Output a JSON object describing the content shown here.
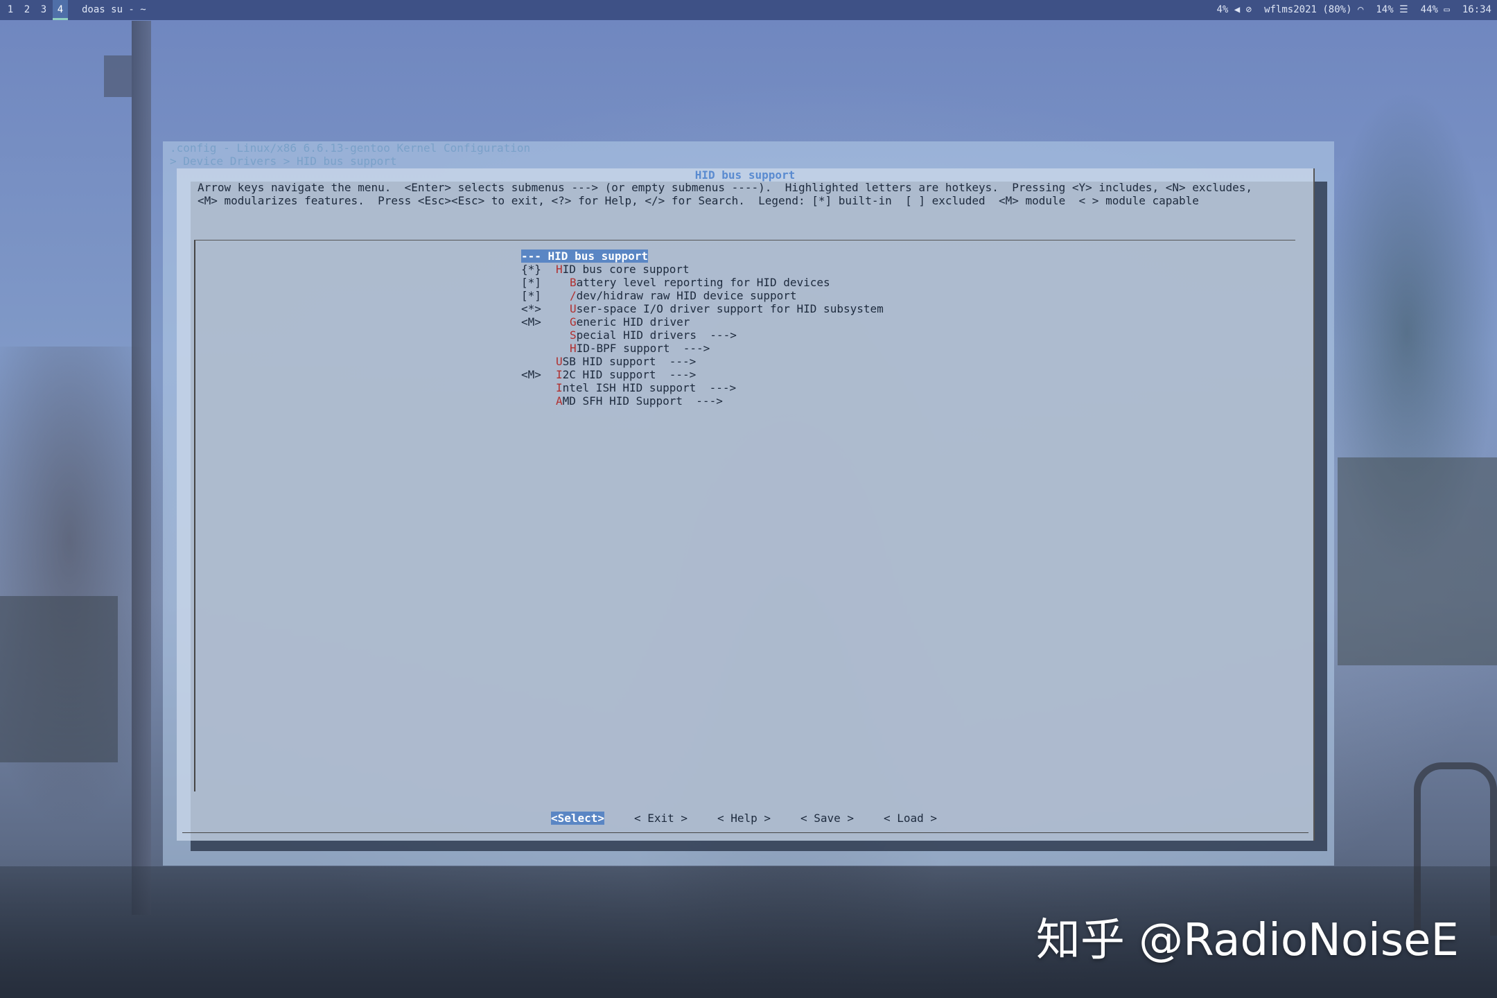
{
  "topbar": {
    "workspaces": [
      "1",
      "2",
      "3",
      "4"
    ],
    "active_workspace": "4",
    "window_title": "doas su - ~",
    "status": {
      "volume": "4%",
      "network": "wflms2021 (80%)",
      "cpu": "14%",
      "battery": "44%",
      "clock": "16:34"
    }
  },
  "terminal": {
    "header_line1": ".config - Linux/x86 6.6.13-gentoo Kernel Configuration",
    "header_line2": "> Device Drivers > HID bus support"
  },
  "dialog": {
    "title": "HID bus support",
    "help_line1": "Arrow keys navigate the menu.  <Enter> selects submenus ---> (or empty submenus ----).  Highlighted letters are hotkeys.  Pressing <Y> includes, <N> excludes,",
    "help_line2": "<M> modularizes features.  Press <Esc><Esc> to exit, <?> for Help, </> for Search.  Legend: [*] built-in  [ ] excluded  <M> module  < > module capable",
    "items": [
      {
        "mark": "",
        "hotkey": "",
        "rest": "--- HID bus support",
        "indent": 0,
        "selected": true
      },
      {
        "mark": "{*}",
        "hotkey": "H",
        "rest": "ID bus core support",
        "indent": 1,
        "selected": false
      },
      {
        "mark": "[*]",
        "hotkey": "B",
        "rest": "attery level reporting for HID devices",
        "indent": 2,
        "selected": false
      },
      {
        "mark": "[*]",
        "hotkey": "/",
        "rest": "dev/hidraw raw HID device support",
        "indent": 2,
        "selected": false
      },
      {
        "mark": "<*>",
        "hotkey": "U",
        "rest": "ser-space I/O driver support for HID subsystem",
        "indent": 2,
        "selected": false
      },
      {
        "mark": "<M>",
        "hotkey": "G",
        "rest": "eneric HID driver",
        "indent": 2,
        "selected": false
      },
      {
        "mark": "",
        "hotkey": "S",
        "rest": "pecial HID drivers  --->",
        "indent": 2,
        "selected": false
      },
      {
        "mark": "",
        "hotkey": "H",
        "rest": "ID-BPF support  --->",
        "indent": 2,
        "selected": false
      },
      {
        "mark": "",
        "hotkey": "U",
        "rest": "SB HID support  --->",
        "indent": 1,
        "selected": false
      },
      {
        "mark": "<M>",
        "hotkey": "I",
        "rest": "2C HID support  --->",
        "indent": 1,
        "selected": false
      },
      {
        "mark": "",
        "hotkey": "I",
        "rest": "ntel ISH HID support  --->",
        "indent": 1,
        "selected": false
      },
      {
        "mark": "",
        "hotkey": "A",
        "rest": "MD SFH HID Support  --->",
        "indent": 1,
        "selected": false
      }
    ],
    "buttons": {
      "select": "<Select>",
      "exit": "< Exit >",
      "help": "< Help >",
      "save": "< Save >",
      "load": "< Load >"
    }
  },
  "watermark": "知乎 @RadioNoiseE"
}
